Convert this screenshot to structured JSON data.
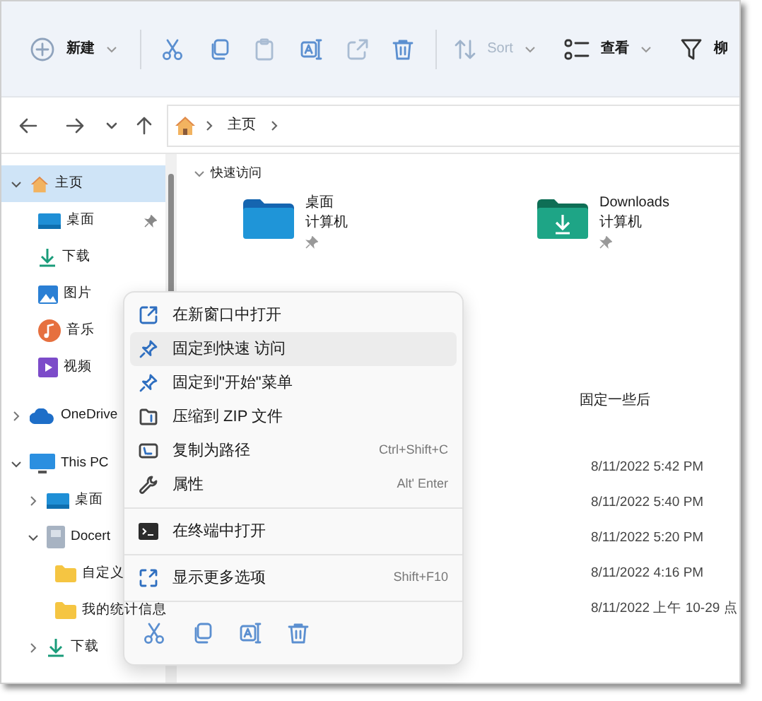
{
  "toolbar": {
    "new_label": "新建",
    "sort_label": "Sort",
    "view_label": "查看",
    "filter_label": "柳",
    "actions": [
      {
        "kind": "cut"
      },
      {
        "kind": "copy"
      },
      {
        "kind": "paste"
      },
      {
        "kind": "rename"
      },
      {
        "kind": "share"
      },
      {
        "kind": "delete"
      }
    ]
  },
  "address": {
    "crumbs": [
      "主页"
    ]
  },
  "sidebar": {
    "items": [
      {
        "label": "主页",
        "kind": "home",
        "expanded": true,
        "selected": true,
        "children": [
          {
            "label": "桌面",
            "kind": "desktop",
            "pinned": true,
            "selected": false
          },
          {
            "label": "下载",
            "kind": "download",
            "pinned": false,
            "selected": false
          },
          {
            "label": "图片",
            "kind": "pictures",
            "pinned": false,
            "selected": false
          },
          {
            "label": "音乐",
            "kind": "music",
            "pinned": false,
            "selected": false
          },
          {
            "label": "视频",
            "kind": "videos",
            "pinned": false,
            "selected": false
          }
        ]
      },
      {
        "label": "OneDrive",
        "kind": "cloud",
        "expanded": false,
        "selected": false
      },
      {
        "label": "This PC",
        "kind": "pc",
        "expanded": true,
        "selected": false,
        "children": [
          {
            "label": "桌面",
            "kind": "desktop",
            "expanded": false,
            "selected": false
          },
          {
            "label": "Docert",
            "kind": "drive",
            "expanded": true,
            "selected": false,
            "children": [
              {
                "label": "自定义",
                "kind": "folder",
                "selected": false
              },
              {
                "label": "我的统计信息",
                "kind": "folder",
                "selected": false
              }
            ]
          },
          {
            "label": "下载",
            "kind": "download",
            "expanded": false,
            "selected": false
          }
        ]
      }
    ]
  },
  "quick_access": {
    "title": "快速访问",
    "tiles": [
      {
        "name": "桌面",
        "location": "计算机",
        "kind": "folder",
        "pinned": true
      },
      {
        "name": "Downloads",
        "location": "计算机",
        "kind": "download-folder",
        "pinned": true
      }
    ]
  },
  "recent": {
    "column_header": "固定一些后",
    "dates": [
      "8/11/2022 5:42 PM",
      "8/11/2022 5:40 PM",
      "8/11/2022 5:20 PM",
      "8/11/2022 4:16 PM",
      "8/11/2022 上午 10-29 点"
    ]
  },
  "context_menu": {
    "groups": [
      [
        {
          "kind": "open-window",
          "label": "在新窗口中打开",
          "selected": false
        },
        {
          "kind": "pin",
          "label": "固定到快速 访问",
          "selected": true
        },
        {
          "kind": "pin",
          "label": "固定到\"开始\"菜单",
          "selected": false
        },
        {
          "kind": "zip",
          "label": "压缩到 ZIP 文件",
          "selected": false
        },
        {
          "kind": "copy-path",
          "label": "复制为路径",
          "shortcut": "Ctrl+Shift+C",
          "selected": false
        },
        {
          "kind": "wrench",
          "label": "属性",
          "shortcut": "Alt' Enter",
          "selected": false
        }
      ],
      [
        {
          "kind": "terminal",
          "label": "在终端中打开",
          "selected": false
        }
      ],
      [
        {
          "kind": "more",
          "label": "显示更多选项",
          "shortcut": "Shift+F10",
          "selected": false
        }
      ]
    ],
    "actions": [
      {
        "kind": "cut"
      },
      {
        "kind": "copy"
      },
      {
        "kind": "rename"
      },
      {
        "kind": "delete"
      }
    ]
  }
}
